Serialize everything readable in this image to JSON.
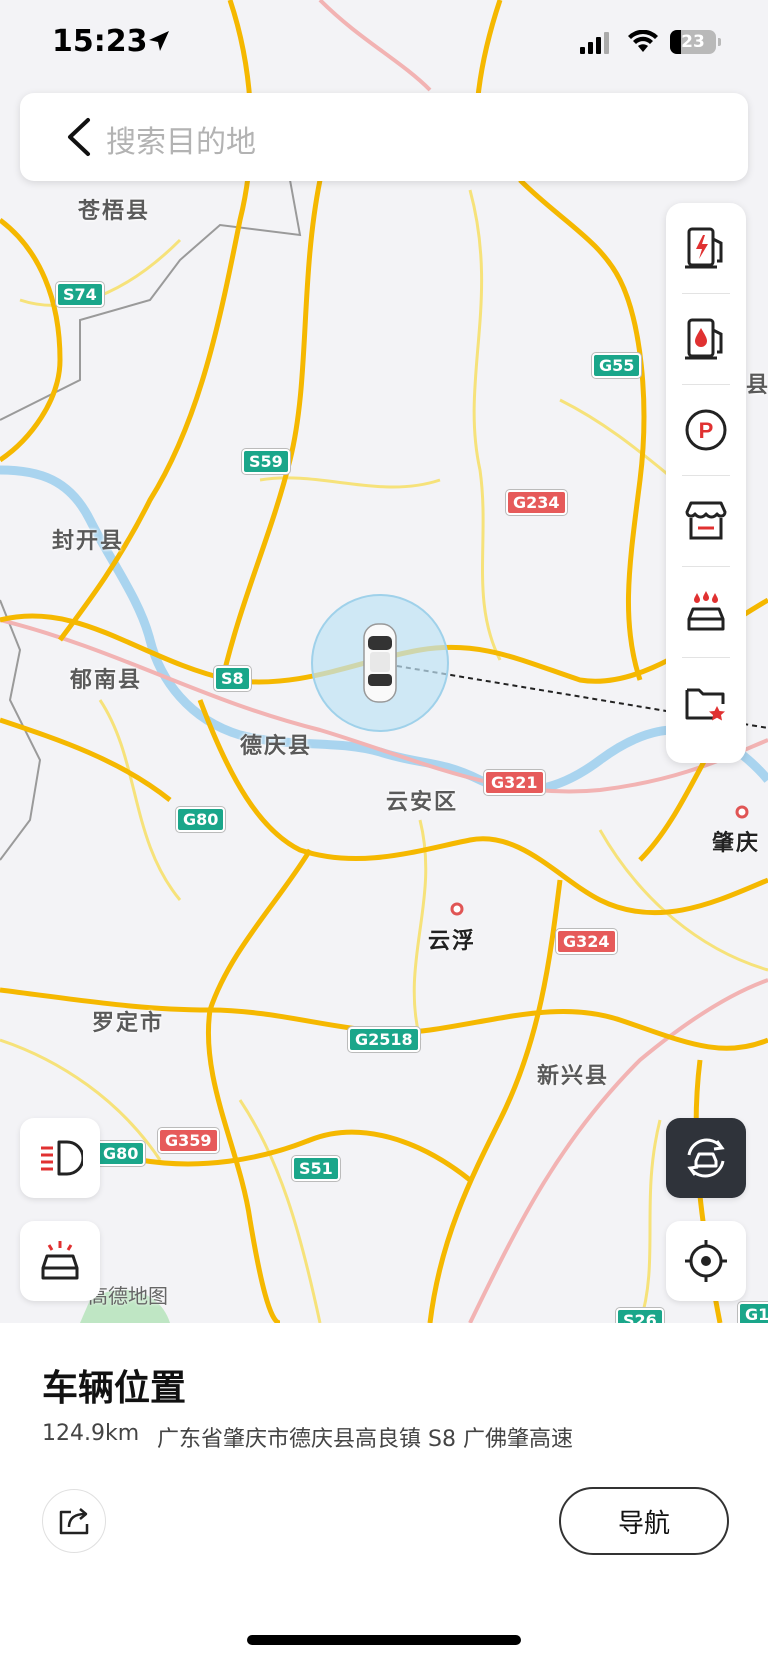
{
  "status_bar": {
    "time": "15:23",
    "battery": "23"
  },
  "search": {
    "placeholder": "搜索目的地"
  },
  "map": {
    "places": {
      "cangwu": "苍梧县",
      "fengkai": "封开县",
      "yunan": "郁南县",
      "deqing": "德庆县",
      "yunan_district": "云安区",
      "yunfu": "云浮",
      "luoding": "罗定市",
      "xinxing": "新兴县",
      "zhaoqing": "肇庆",
      "edge_county": "县"
    },
    "shields": {
      "s74": "S74",
      "g55": "G55",
      "s59": "S59",
      "g234": "G234",
      "s8": "S8",
      "g321": "G321",
      "g80": "G80",
      "g324": "G324",
      "g2518": "G2518",
      "g359": "G359",
      "s51": "S51",
      "g80b": "G80",
      "s26": "S26",
      "g1": "G1"
    },
    "copyright": "高德地图"
  },
  "right_panel": {
    "icons": [
      "charging-station-icon",
      "gas-station-icon",
      "parking-icon",
      "store-icon",
      "car-wash-icon",
      "favorites-folder-icon"
    ]
  },
  "colors": {
    "road_major": "#f5b800",
    "road_minor": "#f6e27a",
    "river": "#a9d4ef",
    "accent_red": "#e03131"
  },
  "sheet": {
    "title": "车辆位置",
    "distance": "124.9km",
    "address": "广东省肇庆市德庆县高良镇 S8 广佛肇高速",
    "nav_label": "导航"
  }
}
